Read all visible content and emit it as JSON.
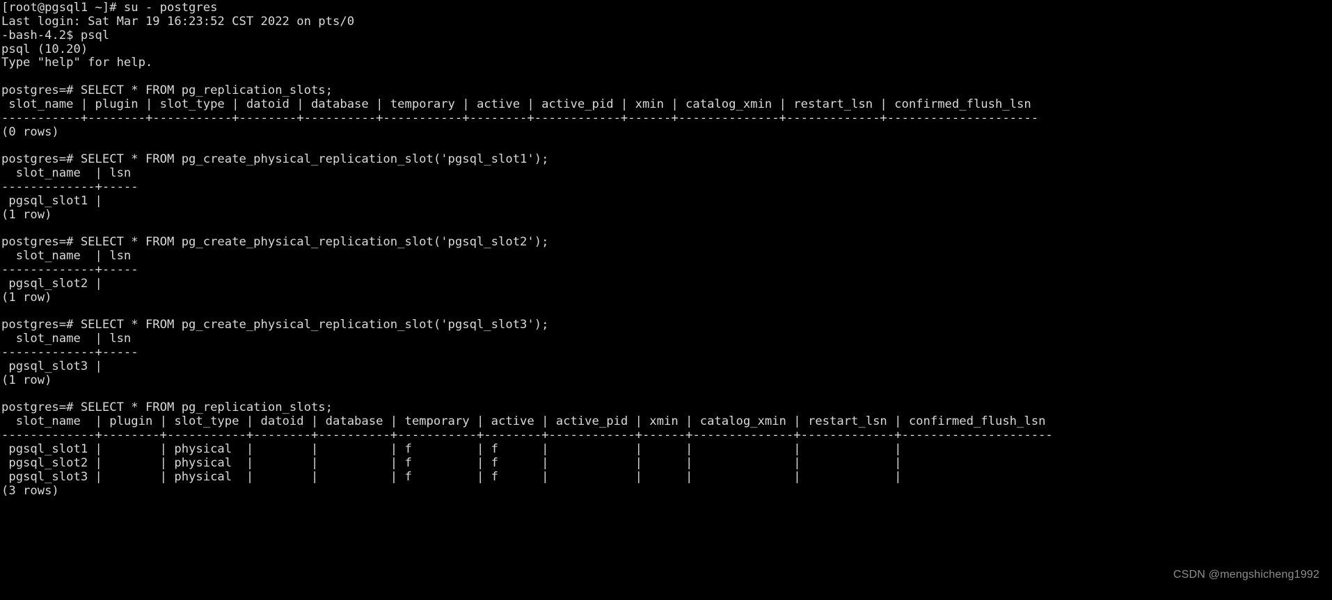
{
  "terminal": {
    "window_title": "psql terminal session",
    "host_prompt": "[root@pgsql1 ~]#",
    "psql_prompt": "postgres=#",
    "shell_prompt": "-bash-4.2$",
    "colors": {
      "background": "#000000",
      "foreground": "#d9d9d9",
      "watermark": "#8e8e8e"
    },
    "lines": [
      "[root@pgsql1 ~]# su - postgres",
      "Last login: Sat Mar 19 16:23:52 CST 2022 on pts/0",
      "-bash-4.2$ psql",
      "psql (10.20)",
      "Type \"help\" for help.",
      "",
      "postgres=# SELECT * FROM pg_replication_slots;",
      " slot_name | plugin | slot_type | datoid | database | temporary | active | active_pid | xmin | catalog_xmin | restart_lsn | confirmed_flush_lsn",
      "-----------+--------+-----------+--------+----------+-----------+--------+------------+------+--------------+-------------+---------------------",
      "(0 rows)",
      "",
      "postgres=# SELECT * FROM pg_create_physical_replication_slot('pgsql_slot1');",
      "  slot_name  | lsn",
      "-------------+-----",
      " pgsql_slot1 |",
      "(1 row)",
      "",
      "postgres=# SELECT * FROM pg_create_physical_replication_slot('pgsql_slot2');",
      "  slot_name  | lsn",
      "-------------+-----",
      " pgsql_slot2 |",
      "(1 row)",
      "",
      "postgres=# SELECT * FROM pg_create_physical_replication_slot('pgsql_slot3');",
      "  slot_name  | lsn",
      "-------------+-----",
      " pgsql_slot3 |",
      "(1 row)",
      "",
      "postgres=# SELECT * FROM pg_replication_slots;",
      "  slot_name  | plugin | slot_type | datoid | database | temporary | active | active_pid | xmin | catalog_xmin | restart_lsn | confirmed_flush_lsn",
      "-------------+--------+-----------+--------+----------+-----------+--------+------------+------+--------------+-------------+---------------------",
      " pgsql_slot1 |        | physical  |        |          | f         | f      |            |      |              |             |",
      " pgsql_slot2 |        | physical  |        |          | f         | f      |            |      |              |             |",
      " pgsql_slot3 |        | physical  |        |          | f         | f      |            |      |              |             |",
      "(3 rows)"
    ],
    "commands": [
      "su - postgres",
      "psql",
      "SELECT * FROM pg_replication_slots;",
      "SELECT * FROM pg_create_physical_replication_slot('pgsql_slot1');",
      "SELECT * FROM pg_create_physical_replication_slot('pgsql_slot2');",
      "SELECT * FROM pg_create_physical_replication_slot('pgsql_slot3');",
      "SELECT * FROM pg_replication_slots;"
    ],
    "login_banner": {
      "last_login": "Last login: Sat Mar 19 16:23:52 CST 2022 on pts/0",
      "psql_version": "psql (10.20)",
      "help_hint": "Type \"help\" for help."
    },
    "replication_slots_table": {
      "columns": [
        "slot_name",
        "plugin",
        "slot_type",
        "datoid",
        "database",
        "temporary",
        "active",
        "active_pid",
        "xmin",
        "catalog_xmin",
        "restart_lsn",
        "confirmed_flush_lsn"
      ],
      "rows": [
        [
          "pgsql_slot1",
          "",
          "physical",
          "",
          "",
          "f",
          "f",
          "",
          "",
          "",
          "",
          ""
        ],
        [
          "pgsql_slot2",
          "",
          "physical",
          "",
          "",
          "f",
          "f",
          "",
          "",
          "",
          "",
          ""
        ],
        [
          "pgsql_slot3",
          "",
          "physical",
          "",
          "",
          "f",
          "f",
          "",
          "",
          "",
          "",
          ""
        ]
      ],
      "row_count_empty": "(0 rows)",
      "row_count_final": "(3 rows)"
    },
    "create_slot_results": {
      "columns": [
        "slot_name",
        "lsn"
      ],
      "rows": [
        [
          "pgsql_slot1",
          ""
        ],
        [
          "pgsql_slot2",
          ""
        ],
        [
          "pgsql_slot3",
          ""
        ]
      ],
      "row_count": "(1 row)"
    },
    "watermark": "CSDN @mengshicheng1992"
  }
}
